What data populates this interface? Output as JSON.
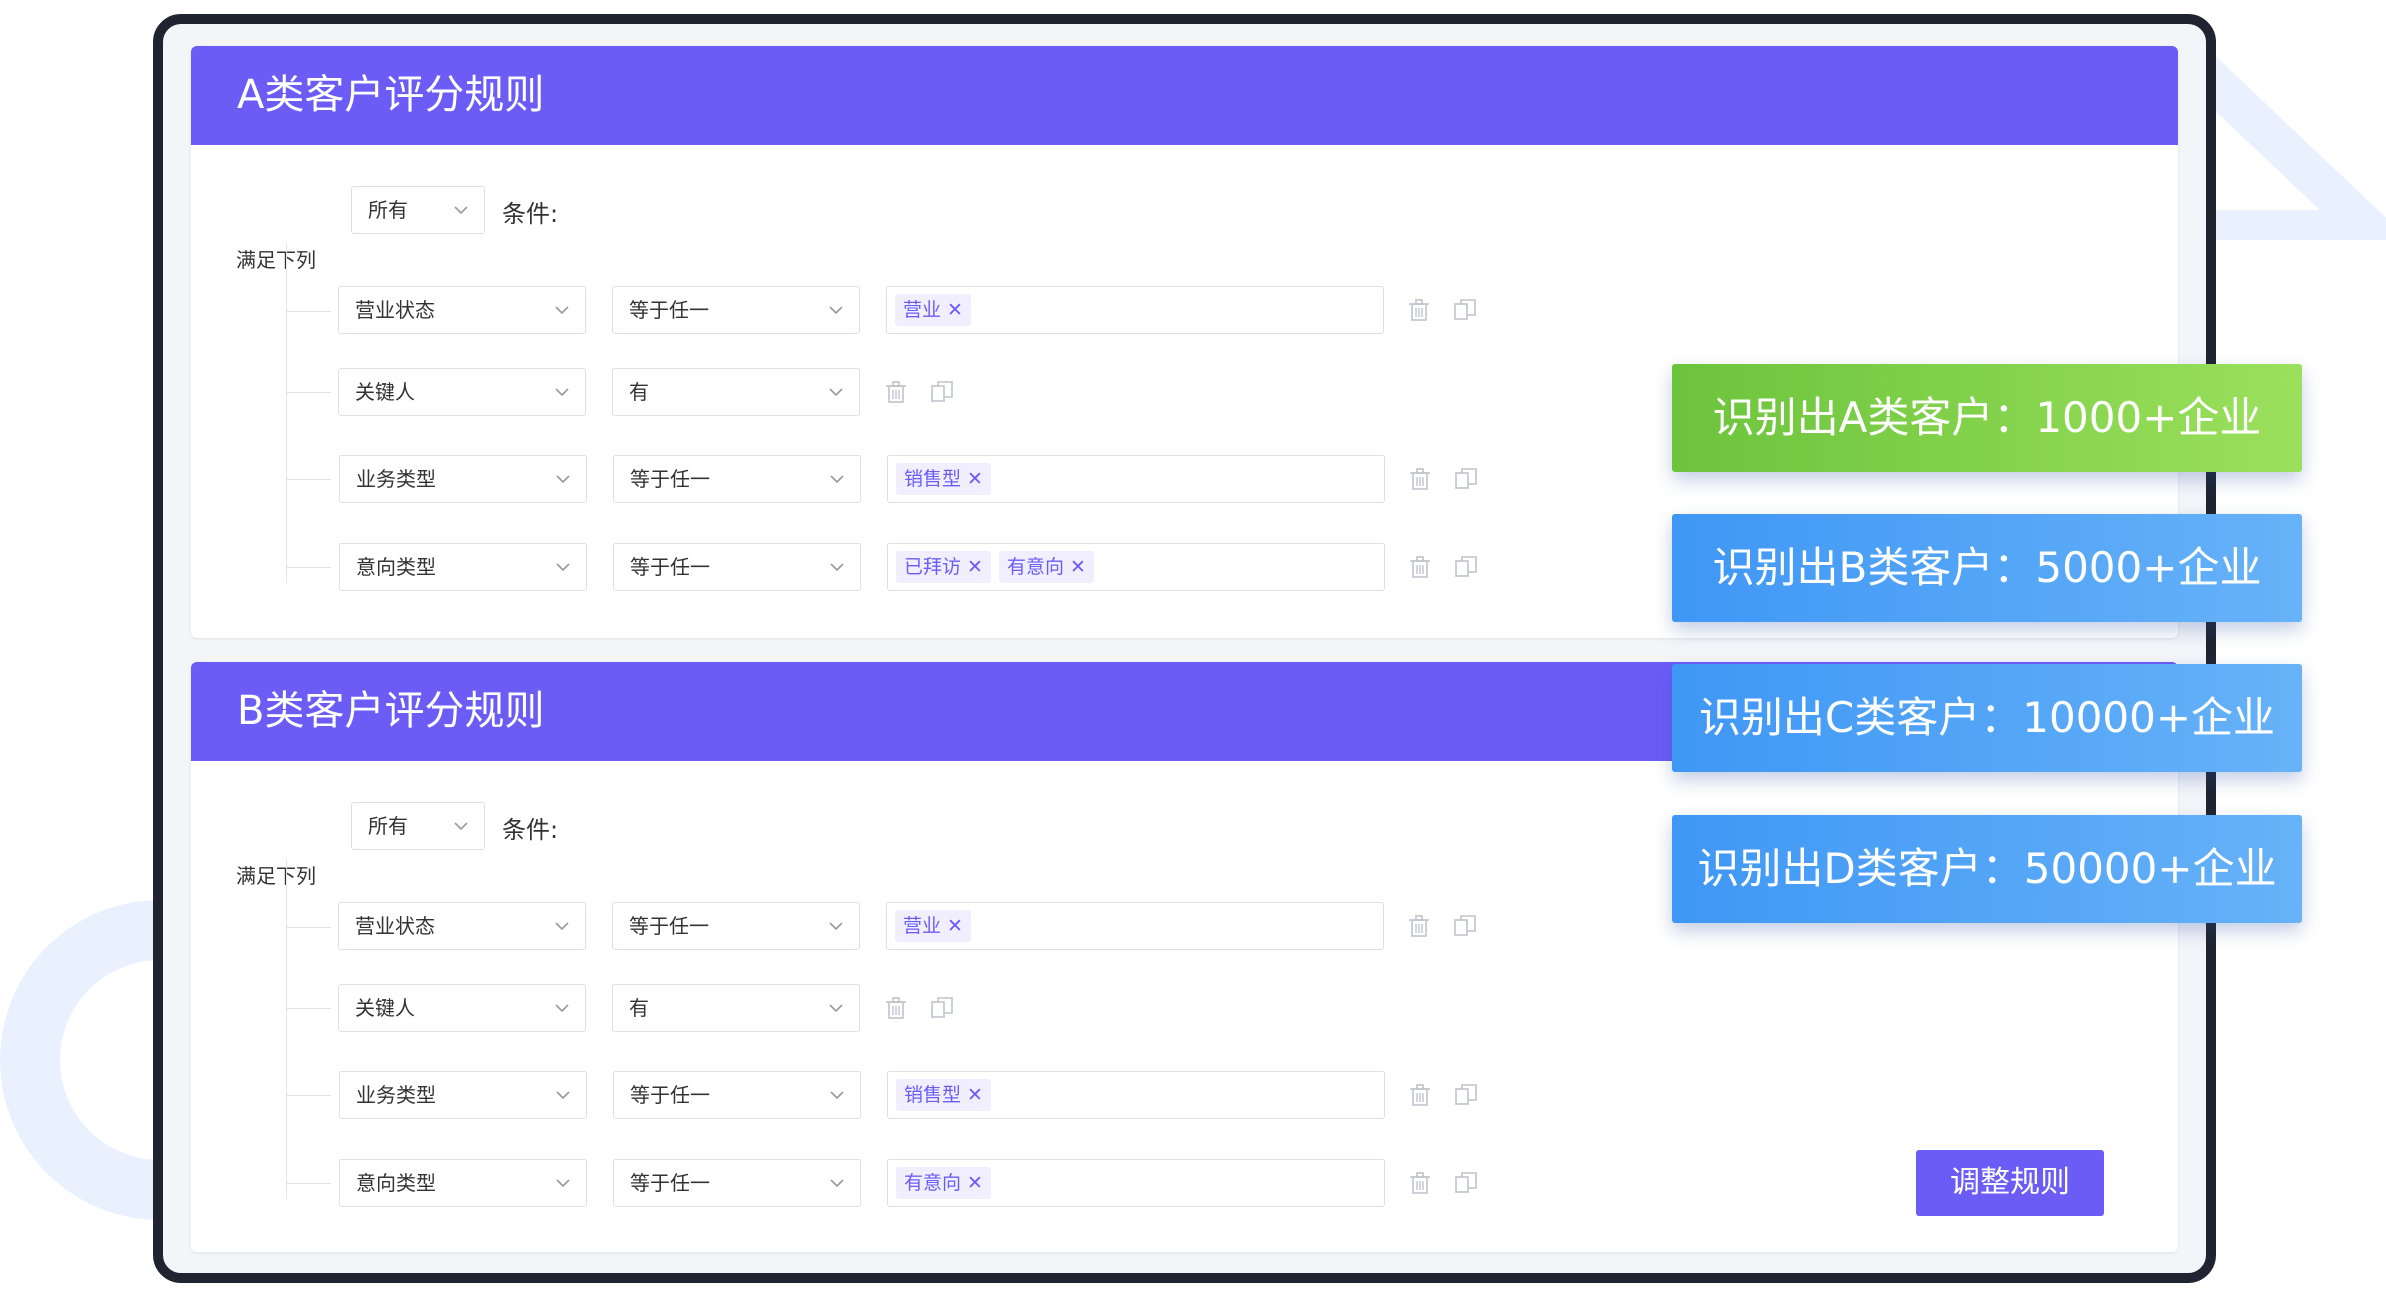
{
  "rule_a": {
    "title": "A类客户评分规则",
    "match_prefix": "满足下列",
    "match_value": "所有",
    "match_suffix": "条件:",
    "rows": [
      {
        "field": "营业状态",
        "operator": "等于任一",
        "tags": [
          "营业"
        ]
      },
      {
        "field": "关键人",
        "operator": "有",
        "tags": []
      },
      {
        "field": "业务类型",
        "operator": "等于任一",
        "tags": [
          "销售型"
        ]
      },
      {
        "field": "意向类型",
        "operator": "等于任一",
        "tags": [
          "已拜访",
          "有意向"
        ]
      }
    ]
  },
  "rule_b": {
    "title": "B类客户评分规则",
    "match_prefix": "满足下列",
    "match_value": "所有",
    "match_suffix": "条件:",
    "rows": [
      {
        "field": "营业状态",
        "operator": "等于任一",
        "tags": [
          "营业"
        ]
      },
      {
        "field": "关键人",
        "operator": "有",
        "tags": []
      },
      {
        "field": "业务类型",
        "operator": "等于任一",
        "tags": [
          "销售型"
        ]
      },
      {
        "field": "意向类型",
        "operator": "等于任一",
        "tags": [
          "有意向"
        ]
      }
    ]
  },
  "badges": {
    "a": "识别出A类客户：1000+企业",
    "b": "识别出B类客户：5000+企业",
    "c": "识别出C类客户：10000+企业",
    "d": "识别出D类客户：50000+企业"
  },
  "adjust_button": "调整规则",
  "tag_remove_glyph": "✕",
  "icons": {
    "chevron": "chevron-down-icon",
    "delete": "trash-icon",
    "copy": "copy-icon"
  },
  "colors": {
    "primary": "#6b5cf6",
    "green": "#6cc43c",
    "blue": "#3f97f5"
  }
}
